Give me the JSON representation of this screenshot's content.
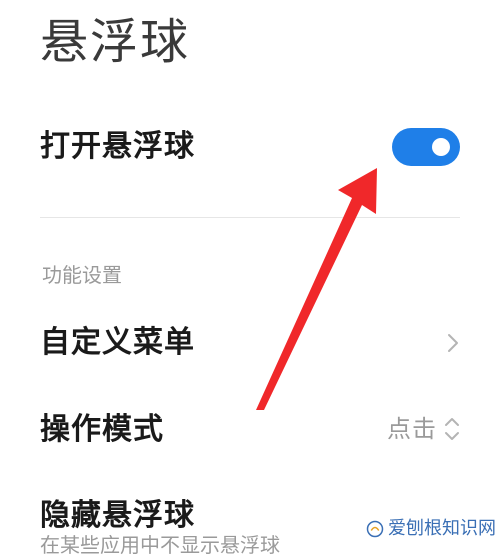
{
  "page": {
    "title": "悬浮球"
  },
  "settings": {
    "enable_row": {
      "label": "打开悬浮球",
      "toggle_on": true
    },
    "section_header": "功能设置",
    "custom_menu": {
      "label": "自定义菜单"
    },
    "operation_mode": {
      "label": "操作模式",
      "value": "点击"
    },
    "hide_ball": {
      "label": "隐藏悬浮球",
      "subtext": "在某些应用中不显示悬浮球"
    }
  },
  "watermark": {
    "text": "爱刨根知识网"
  },
  "colors": {
    "accent": "#1f7fe8",
    "arrow": "#f0282a",
    "secondary_text": "#9a9a9a"
  },
  "icons": {
    "chevron": "chevron-right-icon",
    "selector": "updown-chevron-icon"
  }
}
